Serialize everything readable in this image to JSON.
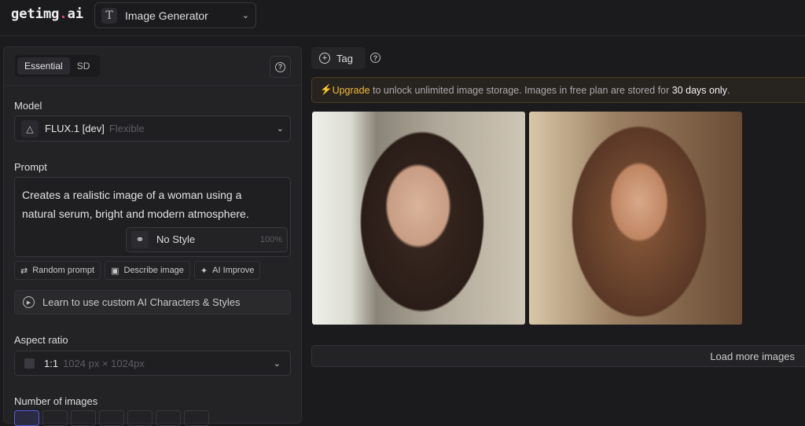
{
  "header": {
    "logo_main": "getimg",
    "logo_dot": ".",
    "logo_tld": "ai",
    "generator_label": "Image Generator"
  },
  "panel": {
    "tabs": [
      "Essential",
      "SD"
    ],
    "model_label": "Model",
    "model_name": "FLUX.1 [dev]",
    "model_sub": "Flexible",
    "prompt_label": "Prompt",
    "prompt_text": "Creates a realistic image of a woman using a natural serum, bright and modern atmosphere.",
    "style_name": "No Style",
    "style_strength": "100%",
    "tools": [
      "Random prompt",
      "Describe image",
      "AI Improve"
    ],
    "learn_label": "Learn to use custom AI Characters & Styles",
    "aspect_label": "Aspect ratio",
    "aspect_ratio": "1:1",
    "aspect_dims": "1024 px × 1024px",
    "num_images_label": "Number of images"
  },
  "main": {
    "tag_label": "Tag",
    "banner": {
      "upgrade": "Upgrade",
      "text1": " to unlock unlimited image storage. Images in free plan are stored for ",
      "bold": "30 days only",
      "text2": "."
    },
    "load_more": "Load more images"
  }
}
